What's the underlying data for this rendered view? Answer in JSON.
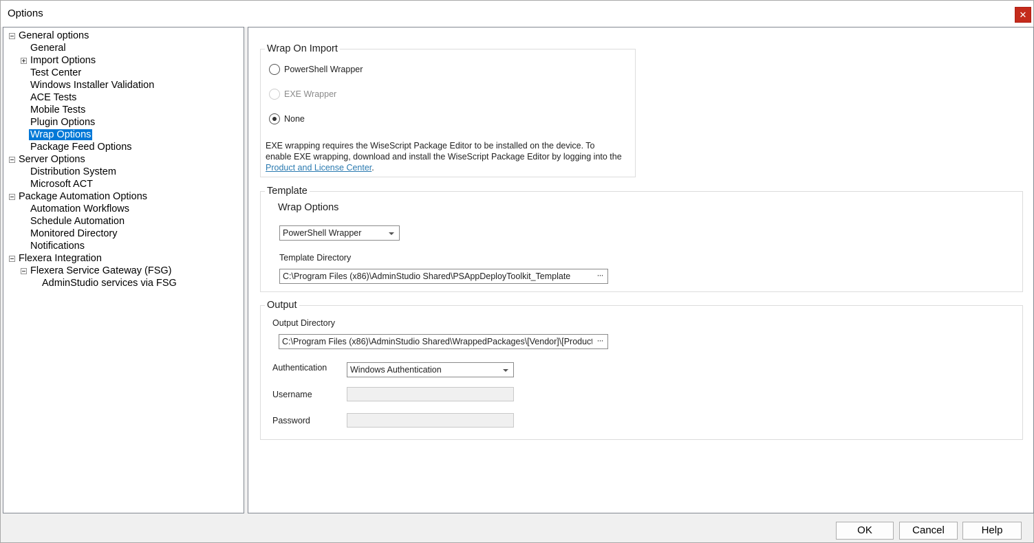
{
  "window": {
    "title": "Options",
    "close_glyph": "✕"
  },
  "tree": {
    "items": [
      {
        "label": "General options",
        "expander": "minus"
      },
      {
        "label": "General"
      },
      {
        "label": "Import Options",
        "expander": "plus"
      },
      {
        "label": "Test Center"
      },
      {
        "label": "Windows Installer Validation"
      },
      {
        "label": "ACE Tests"
      },
      {
        "label": "Mobile Tests"
      },
      {
        "label": "Plugin Options"
      },
      {
        "label": "Wrap Options",
        "selected": true
      },
      {
        "label": "Package Feed Options"
      },
      {
        "label": "Server Options",
        "expander": "minus"
      },
      {
        "label": "Distribution System"
      },
      {
        "label": "Microsoft ACT"
      },
      {
        "label": "Package Automation Options",
        "expander": "minus"
      },
      {
        "label": "Automation Workflows"
      },
      {
        "label": "Schedule Automation"
      },
      {
        "label": "Monitored Directory"
      },
      {
        "label": "Notifications"
      },
      {
        "label": "Flexera Integration",
        "expander": "minus"
      },
      {
        "label": "Flexera Service Gateway (FSG)",
        "expander": "minus"
      },
      {
        "label": "AdminStudio services via FSG"
      }
    ]
  },
  "wrap_on_import": {
    "legend": "Wrap On Import",
    "options": [
      {
        "label": "PowerShell Wrapper",
        "checked": false,
        "disabled": false
      },
      {
        "label": "EXE Wrapper",
        "checked": false,
        "disabled": true
      },
      {
        "label": "None",
        "checked": true,
        "disabled": false
      }
    ],
    "note_line1": "EXE wrapping requires the WiseScript Package Editor to be installed on the device. To",
    "note_line2": "enable EXE wrapping, download and install the WiseScript Package Editor by logging into the",
    "note_link": "Product and License Center",
    "note_end": "."
  },
  "template": {
    "legend": "Template",
    "wrap_options_heading": "Wrap Options",
    "wrap_options_value": "PowerShell Wrapper",
    "template_directory_label": "Template Directory",
    "template_directory_value": "C:\\Program Files (x86)\\AdminStudio Shared\\PSAppDeployToolkit_Template",
    "browse_glyph": "···"
  },
  "output": {
    "legend": "Output",
    "output_directory_label": "Output Directory",
    "output_directory_value": "C:\\Program Files (x86)\\AdminStudio Shared\\WrappedPackages\\[Vendor]\\[Product]",
    "authentication_label": "Authentication",
    "authentication_value": "Windows Authentication",
    "username_label": "Username",
    "password_label": "Password",
    "browse_glyph": "···"
  },
  "footer": {
    "ok_label": "OK",
    "cancel_label": "Cancel",
    "help_label": "Help"
  }
}
